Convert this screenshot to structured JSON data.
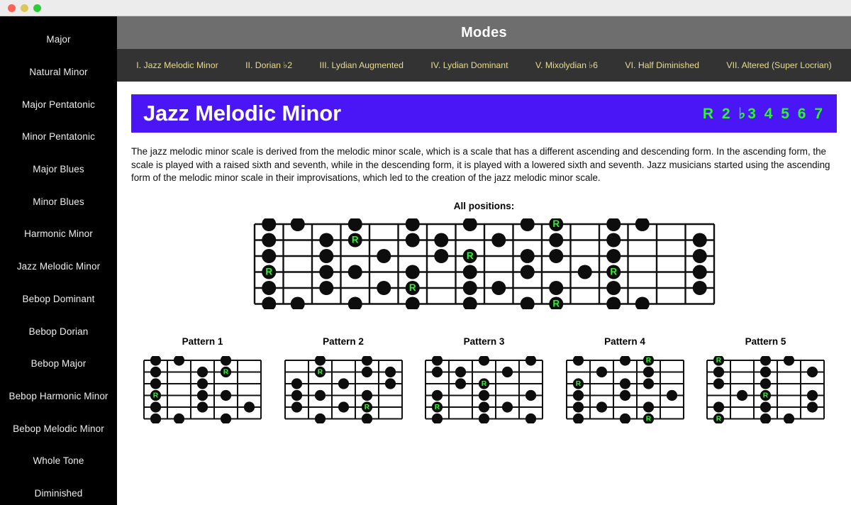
{
  "window": {
    "traffic_lights": [
      {
        "name": "close",
        "color": "#ff6257"
      },
      {
        "name": "minimize",
        "color": "#ddc75c"
      },
      {
        "name": "maximize",
        "color": "#2fcc37"
      }
    ]
  },
  "sidebar": {
    "items": [
      {
        "label": "Major",
        "active": false
      },
      {
        "label": "Natural Minor",
        "active": false
      },
      {
        "label": "Major Pentatonic",
        "active": false
      },
      {
        "label": "Minor Pentatonic",
        "active": false
      },
      {
        "label": "Major Blues",
        "active": false
      },
      {
        "label": "Minor Blues",
        "active": false
      },
      {
        "label": "Harmonic Minor",
        "active": false
      },
      {
        "label": "Jazz Melodic Minor",
        "active": true
      },
      {
        "label": "Bebop Dominant",
        "active": false
      },
      {
        "label": "Bebop Dorian",
        "active": false
      },
      {
        "label": "Bebop Major",
        "active": false
      },
      {
        "label": "Bebop Harmonic Minor",
        "active": false
      },
      {
        "label": "Bebop Melodic Minor",
        "active": false
      },
      {
        "label": "Whole Tone",
        "active": false
      },
      {
        "label": "Diminished",
        "active": false
      }
    ]
  },
  "header": {
    "title": "Modes",
    "background": "#6e6e6e"
  },
  "tabs": {
    "background": "#333333",
    "text_color": "#e8dd8a",
    "items": [
      {
        "label": "I. Jazz Melodic Minor",
        "active": true
      },
      {
        "label": "II. Dorian ♭2",
        "active": false
      },
      {
        "label": "III. Lydian Augmented",
        "active": false
      },
      {
        "label": "IV. Lydian Dominant",
        "active": false
      },
      {
        "label": "V. Mixolydian ♭6",
        "active": false
      },
      {
        "label": "VI. Half Diminished",
        "active": false
      },
      {
        "label": "VII. Altered (Super Locrian)",
        "active": false
      }
    ]
  },
  "scale": {
    "name": "Jazz Melodic Minor",
    "degrees": "R 2 ♭3 4 5 6 7",
    "banner_color": "#4b16f5",
    "degree_color": "#2bf52b",
    "description": "The jazz melodic minor scale is derived from the melodic minor scale, which is a scale that has a different ascending and descending form. In the ascending form, the scale is played with a raised sixth and seventh, while in the descending form, it is played with a lowered sixth and seventh. Jazz musicians started using the ascending form of the melodic minor scale in their improvisations, which led to the creation of the jazz melodic minor scale."
  },
  "diagrams": {
    "all_positions_label": "All positions:",
    "root_marker": "R",
    "dot_color": "#0d0d0d",
    "root_text_color": "#2bf52b",
    "all_positions": {
      "strings": 6,
      "frets": 16,
      "notes": [
        {
          "string": 1,
          "fret": 1,
          "root": false
        },
        {
          "string": 1,
          "fret": 2,
          "root": false
        },
        {
          "string": 1,
          "fret": 4,
          "root": false
        },
        {
          "string": 1,
          "fret": 6,
          "root": false
        },
        {
          "string": 1,
          "fret": 8,
          "root": false
        },
        {
          "string": 1,
          "fret": 10,
          "root": false
        },
        {
          "string": 1,
          "fret": 11,
          "root": true
        },
        {
          "string": 1,
          "fret": 13,
          "root": false
        },
        {
          "string": 1,
          "fret": 14,
          "root": false
        },
        {
          "string": 2,
          "fret": 1,
          "root": false
        },
        {
          "string": 2,
          "fret": 3,
          "root": false
        },
        {
          "string": 2,
          "fret": 4,
          "root": true
        },
        {
          "string": 2,
          "fret": 6,
          "root": false
        },
        {
          "string": 2,
          "fret": 7,
          "root": false
        },
        {
          "string": 2,
          "fret": 9,
          "root": false
        },
        {
          "string": 2,
          "fret": 11,
          "root": false
        },
        {
          "string": 2,
          "fret": 13,
          "root": false
        },
        {
          "string": 2,
          "fret": 16,
          "root": false
        },
        {
          "string": 3,
          "fret": 1,
          "root": false
        },
        {
          "string": 3,
          "fret": 3,
          "root": false
        },
        {
          "string": 3,
          "fret": 5,
          "root": false
        },
        {
          "string": 3,
          "fret": 7,
          "root": false
        },
        {
          "string": 3,
          "fret": 8,
          "root": true
        },
        {
          "string": 3,
          "fret": 10,
          "root": false
        },
        {
          "string": 3,
          "fret": 11,
          "root": false
        },
        {
          "string": 3,
          "fret": 13,
          "root": false
        },
        {
          "string": 3,
          "fret": 16,
          "root": false
        },
        {
          "string": 4,
          "fret": 1,
          "root": true
        },
        {
          "string": 4,
          "fret": 3,
          "root": false
        },
        {
          "string": 4,
          "fret": 4,
          "root": false
        },
        {
          "string": 4,
          "fret": 6,
          "root": false
        },
        {
          "string": 4,
          "fret": 8,
          "root": false
        },
        {
          "string": 4,
          "fret": 10,
          "root": false
        },
        {
          "string": 4,
          "fret": 12,
          "root": false
        },
        {
          "string": 4,
          "fret": 13,
          "root": true
        },
        {
          "string": 4,
          "fret": 16,
          "root": false
        },
        {
          "string": 5,
          "fret": 1,
          "root": false
        },
        {
          "string": 5,
          "fret": 3,
          "root": false
        },
        {
          "string": 5,
          "fret": 5,
          "root": false
        },
        {
          "string": 5,
          "fret": 6,
          "root": true
        },
        {
          "string": 5,
          "fret": 8,
          "root": false
        },
        {
          "string": 5,
          "fret": 9,
          "root": false
        },
        {
          "string": 5,
          "fret": 11,
          "root": false
        },
        {
          "string": 5,
          "fret": 13,
          "root": false
        },
        {
          "string": 5,
          "fret": 16,
          "root": false
        },
        {
          "string": 6,
          "fret": 1,
          "root": false
        },
        {
          "string": 6,
          "fret": 2,
          "root": false
        },
        {
          "string": 6,
          "fret": 4,
          "root": false
        },
        {
          "string": 6,
          "fret": 6,
          "root": false
        },
        {
          "string": 6,
          "fret": 8,
          "root": false
        },
        {
          "string": 6,
          "fret": 10,
          "root": false
        },
        {
          "string": 6,
          "fret": 11,
          "root": true
        },
        {
          "string": 6,
          "fret": 13,
          "root": false
        },
        {
          "string": 6,
          "fret": 14,
          "root": false
        }
      ]
    },
    "patterns": [
      {
        "title": "Pattern 1",
        "strings": 6,
        "frets": 5,
        "notes": [
          {
            "string": 1,
            "fret": 1,
            "root": false
          },
          {
            "string": 1,
            "fret": 2,
            "root": false
          },
          {
            "string": 1,
            "fret": 4,
            "root": false
          },
          {
            "string": 2,
            "fret": 1,
            "root": false
          },
          {
            "string": 2,
            "fret": 3,
            "root": false
          },
          {
            "string": 2,
            "fret": 4,
            "root": true
          },
          {
            "string": 3,
            "fret": 1,
            "root": false
          },
          {
            "string": 3,
            "fret": 3,
            "root": false
          },
          {
            "string": 4,
            "fret": 1,
            "root": true
          },
          {
            "string": 4,
            "fret": 3,
            "root": false
          },
          {
            "string": 4,
            "fret": 4,
            "root": false
          },
          {
            "string": 5,
            "fret": 1,
            "root": false
          },
          {
            "string": 5,
            "fret": 3,
            "root": false
          },
          {
            "string": 5,
            "fret": 5,
            "root": false
          },
          {
            "string": 6,
            "fret": 1,
            "root": false
          },
          {
            "string": 6,
            "fret": 2,
            "root": false
          },
          {
            "string": 6,
            "fret": 4,
            "root": false
          }
        ]
      },
      {
        "title": "Pattern 2",
        "strings": 6,
        "frets": 5,
        "notes": [
          {
            "string": 1,
            "fret": 2,
            "root": false
          },
          {
            "string": 1,
            "fret": 4,
            "root": false
          },
          {
            "string": 2,
            "fret": 2,
            "root": true
          },
          {
            "string": 2,
            "fret": 4,
            "root": false
          },
          {
            "string": 2,
            "fret": 5,
            "root": false
          },
          {
            "string": 3,
            "fret": 1,
            "root": false
          },
          {
            "string": 3,
            "fret": 3,
            "root": false
          },
          {
            "string": 3,
            "fret": 5,
            "root": false
          },
          {
            "string": 4,
            "fret": 1,
            "root": false
          },
          {
            "string": 4,
            "fret": 2,
            "root": false
          },
          {
            "string": 4,
            "fret": 4,
            "root": false
          },
          {
            "string": 5,
            "fret": 1,
            "root": false
          },
          {
            "string": 5,
            "fret": 3,
            "root": false
          },
          {
            "string": 5,
            "fret": 4,
            "root": true
          },
          {
            "string": 6,
            "fret": 2,
            "root": false
          },
          {
            "string": 6,
            "fret": 4,
            "root": false
          }
        ]
      },
      {
        "title": "Pattern 3",
        "strings": 6,
        "frets": 5,
        "notes": [
          {
            "string": 1,
            "fret": 1,
            "root": false
          },
          {
            "string": 1,
            "fret": 3,
            "root": false
          },
          {
            "string": 1,
            "fret": 5,
            "root": false
          },
          {
            "string": 2,
            "fret": 1,
            "root": false
          },
          {
            "string": 2,
            "fret": 2,
            "root": false
          },
          {
            "string": 2,
            "fret": 4,
            "root": false
          },
          {
            "string": 3,
            "fret": 2,
            "root": false
          },
          {
            "string": 3,
            "fret": 3,
            "root": true
          },
          {
            "string": 4,
            "fret": 1,
            "root": false
          },
          {
            "string": 4,
            "fret": 3,
            "root": false
          },
          {
            "string": 4,
            "fret": 5,
            "root": false
          },
          {
            "string": 5,
            "fret": 1,
            "root": true
          },
          {
            "string": 5,
            "fret": 3,
            "root": false
          },
          {
            "string": 5,
            "fret": 4,
            "root": false
          },
          {
            "string": 6,
            "fret": 1,
            "root": false
          },
          {
            "string": 6,
            "fret": 3,
            "root": false
          },
          {
            "string": 6,
            "fret": 5,
            "root": false
          }
        ]
      },
      {
        "title": "Pattern 4",
        "strings": 6,
        "frets": 5,
        "notes": [
          {
            "string": 1,
            "fret": 1,
            "root": false
          },
          {
            "string": 1,
            "fret": 3,
            "root": false
          },
          {
            "string": 1,
            "fret": 4,
            "root": true
          },
          {
            "string": 2,
            "fret": 2,
            "root": false
          },
          {
            "string": 2,
            "fret": 4,
            "root": false
          },
          {
            "string": 3,
            "fret": 1,
            "root": true
          },
          {
            "string": 3,
            "fret": 3,
            "root": false
          },
          {
            "string": 3,
            "fret": 4,
            "root": false
          },
          {
            "string": 4,
            "fret": 1,
            "root": false
          },
          {
            "string": 4,
            "fret": 3,
            "root": false
          },
          {
            "string": 4,
            "fret": 5,
            "root": false
          },
          {
            "string": 5,
            "fret": 1,
            "root": false
          },
          {
            "string": 5,
            "fret": 2,
            "root": false
          },
          {
            "string": 5,
            "fret": 4,
            "root": false
          },
          {
            "string": 6,
            "fret": 1,
            "root": false
          },
          {
            "string": 6,
            "fret": 3,
            "root": false
          },
          {
            "string": 6,
            "fret": 4,
            "root": true
          }
        ]
      },
      {
        "title": "Pattern 5",
        "strings": 6,
        "frets": 5,
        "notes": [
          {
            "string": 1,
            "fret": 1,
            "root": true
          },
          {
            "string": 1,
            "fret": 3,
            "root": false
          },
          {
            "string": 1,
            "fret": 4,
            "root": false
          },
          {
            "string": 2,
            "fret": 1,
            "root": false
          },
          {
            "string": 2,
            "fret": 3,
            "root": false
          },
          {
            "string": 2,
            "fret": 5,
            "root": false
          },
          {
            "string": 3,
            "fret": 1,
            "root": false
          },
          {
            "string": 3,
            "fret": 3,
            "root": false
          },
          {
            "string": 4,
            "fret": 2,
            "root": false
          },
          {
            "string": 4,
            "fret": 3,
            "root": true
          },
          {
            "string": 4,
            "fret": 5,
            "root": false
          },
          {
            "string": 5,
            "fret": 1,
            "root": false
          },
          {
            "string": 5,
            "fret": 3,
            "root": false
          },
          {
            "string": 5,
            "fret": 5,
            "root": false
          },
          {
            "string": 6,
            "fret": 1,
            "root": true
          },
          {
            "string": 6,
            "fret": 3,
            "root": false
          },
          {
            "string": 6,
            "fret": 4,
            "root": false
          }
        ]
      }
    ]
  }
}
